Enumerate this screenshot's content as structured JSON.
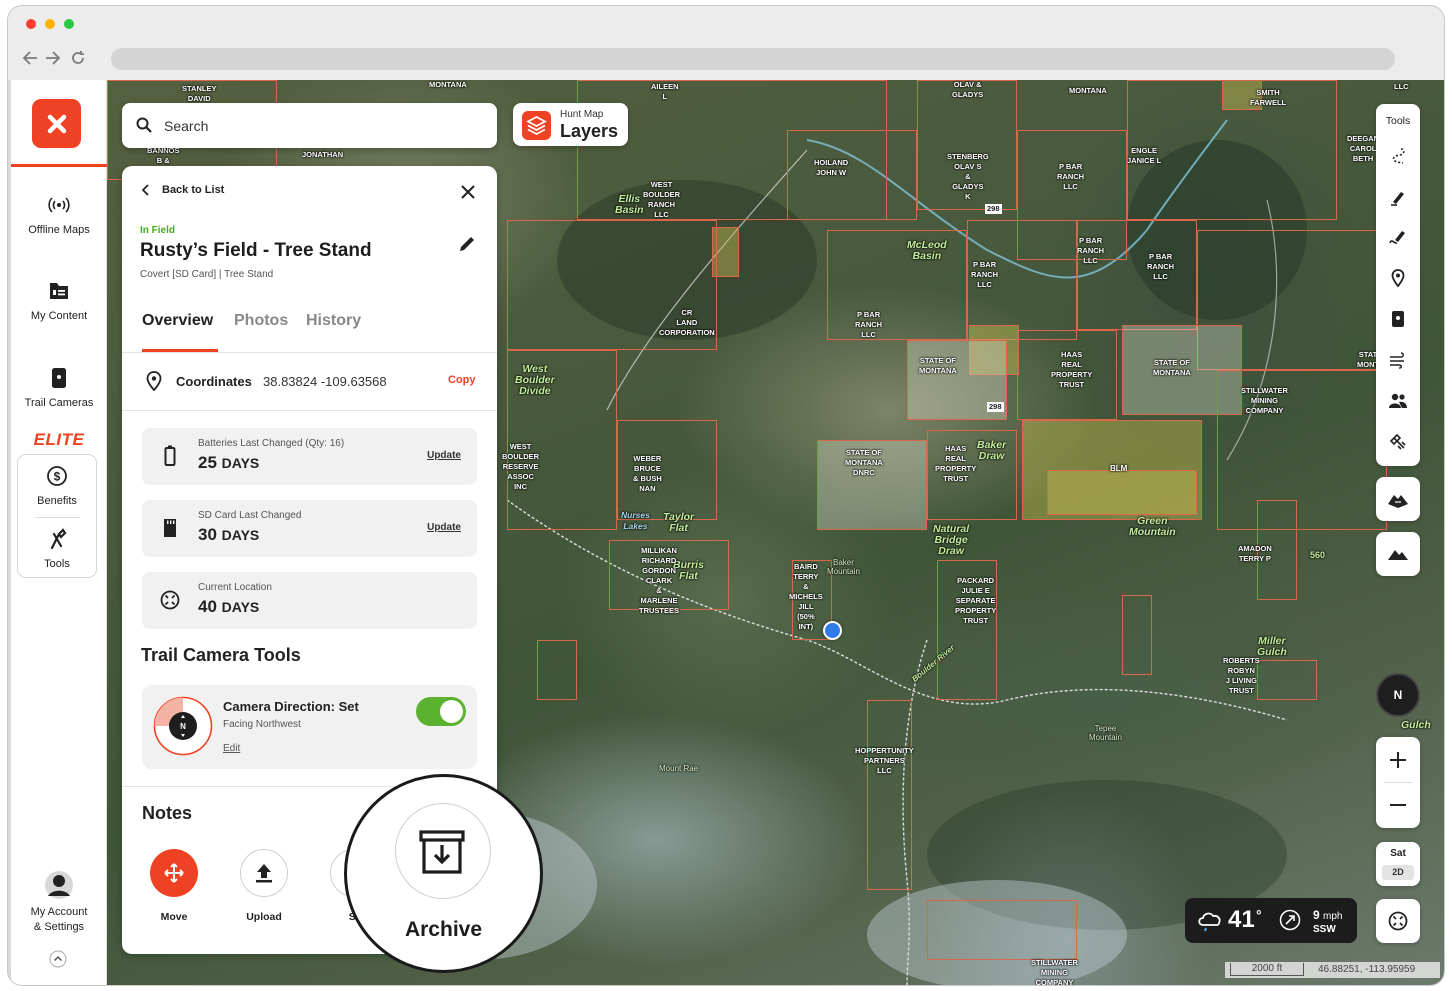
{
  "browser": {
    "dots": [
      "#ff3b30",
      "#ffb300",
      "#28c840"
    ]
  },
  "sidebar": {
    "items": [
      {
        "label": "Offline Maps",
        "icon": "offline-maps-icon"
      },
      {
        "label": "My Content",
        "icon": "content-icon"
      },
      {
        "label": "Trail Cameras",
        "icon": "trail-camera-icon"
      }
    ],
    "elite_label": "ELITE",
    "elite_items": [
      {
        "label": "Benefits",
        "icon": "dollar-icon"
      },
      {
        "label": "Tools",
        "icon": "tools-icon"
      }
    ],
    "account_label_1": "My Account",
    "account_label_2": "& Settings"
  },
  "search": {
    "placeholder": "Search"
  },
  "layers": {
    "small": "Hunt Map",
    "big": "Layers"
  },
  "panel": {
    "back_label": "Back to List",
    "status": "In Field",
    "title": "Rusty’s Field - Tree Stand",
    "subtitle": "Covert [SD Card] | Tree Stand",
    "tabs": [
      "Overview",
      "Photos",
      "History"
    ],
    "coordinates_label": "Coordinates",
    "coordinates_value": "38.83824  -109.63568",
    "copy_label": "Copy",
    "cards": [
      {
        "label": "Batteries Last Changed (Qty: 16)",
        "num": "25",
        "unit": "DAYS",
        "action": "Update"
      },
      {
        "label": "SD Card Last Changed",
        "num": "30",
        "unit": "DAYS",
        "action": "Update"
      },
      {
        "label": "Current Location",
        "num": "40",
        "unit": "DAYS",
        "action": ""
      }
    ],
    "tools_heading": "Trail Camera Tools",
    "camera_direction": {
      "title": "Camera Direction: Set",
      "sub": "Facing Northwest",
      "edit": "Edit",
      "compass_letter": "N",
      "enabled": true
    },
    "notes_heading": "Notes",
    "actions": [
      {
        "label": "Move"
      },
      {
        "label": "Upload"
      },
      {
        "label": "St"
      }
    ]
  },
  "zoom_callout": {
    "label": "Archive"
  },
  "toolbar": {
    "title": "Tools"
  },
  "compass": {
    "label": "N"
  },
  "map_type": {
    "top": "Sat",
    "bottom": "2D"
  },
  "weather": {
    "temp": "41",
    "degree": "°",
    "wind_speed": "9",
    "wind_unit": "mph",
    "wind_dir": "SSW"
  },
  "scale": {
    "distance": "2000 ft",
    "coords": "46.88251, -113.95959"
  },
  "colors": {
    "accent": "#ef4123",
    "status_green": "#44aa1f",
    "toggle_green": "#5bb22f",
    "parcel": "#d9674a",
    "pin": "#2f7bea"
  },
  "map_labels": [
    "STANLEY\nDAVID",
    "MONTANA",
    "AILEEN\nL",
    "OLAV &\nGLADYS",
    "MONTANA",
    "SMITH\nFARWELL",
    "LLC",
    "BANNOS\nB &",
    "JONATHAN",
    "HOILAND\nJOHN W",
    "STENBERG\nOLAV S\n&\nGLADYS\nK",
    "P BAR\nRANCH\nLLC",
    "ENGLE\nJANICE L",
    "DEEGAN\nCAROL\nBETH",
    "WEST\nBOULDER\nRANCH\nLLC",
    "Ellis\nBasin",
    "McLeod\nBasin",
    "P BAR\nRANCH\nLLC",
    "P BAR\nRANCH\nLLC",
    "P BAR\nRANCH\nLLC",
    "CR\nLAND\nCORPORATION",
    "P BAR\nRANCH\nLLC",
    "West\nBoulder\nDivide",
    "STATE OF\nMONTANA",
    "HAAS\nREAL\nPROPERTY\nTRUST",
    "STATE OF\nMONTANA",
    "STATE\nMONTA",
    "STILLWATER\nMINING\nCOMPANY",
    "WEST\nBOULDER\nRESERVE\nASSOC\nINC",
    "WEBER\nBRUCE\n& BUSH\nNAN",
    "STATE OF\nMONTANA\nDNRC",
    "HAAS\nREAL\nPROPERTY\nTRUST",
    "Baker\nDraw",
    "BLM",
    "Green\nMountain",
    "Nurses\nLakes",
    "Taylor\nFlat",
    "Burris\nFlat",
    "MILLIKAN\nRICHARD\nGORDON\nCLARK\n&\nMARLENE\nTRUSTEES",
    "BAIRD\nTERRY\n&\nMICHELS\nJILL\n(50%\nINT)",
    "Baker\nMountain",
    "Natural\nBridge\nDraw",
    "PACKARD\nJULIE E\nSEPARATE\nPROPERTY\nTRUST",
    "AMADON\nTERRY P",
    "560",
    "Boulder River",
    "HOPPERTUNITY\nPARTNERS\nLLC",
    "Mount Rae",
    "Tepee\nMountain",
    "ROBERTS\nROBYN\nJ LIVING\nTRUST",
    "Miller\nGulch",
    "Gulch",
    "STILLWATER\nMINING\nCOMPANY",
    "298",
    "298"
  ]
}
